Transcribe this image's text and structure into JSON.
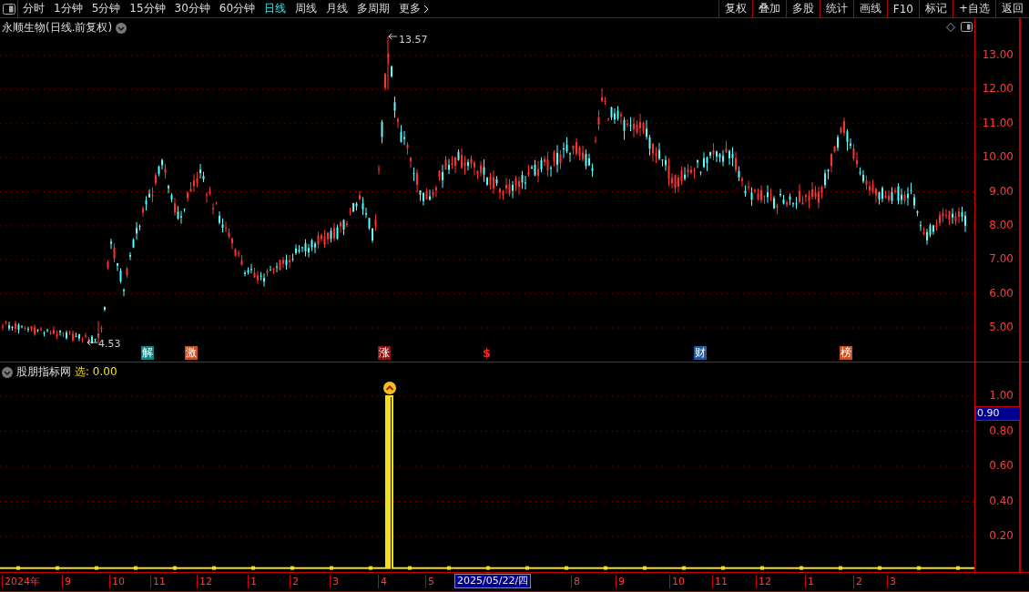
{
  "toolbar": {
    "periods": [
      {
        "label": "分时",
        "selected": false
      },
      {
        "label": "1分钟",
        "selected": false
      },
      {
        "label": "5分钟",
        "selected": false
      },
      {
        "label": "15分钟",
        "selected": false
      },
      {
        "label": "30分钟",
        "selected": false
      },
      {
        "label": "60分钟",
        "selected": false
      },
      {
        "label": "日线",
        "selected": true
      },
      {
        "label": "周线",
        "selected": false
      },
      {
        "label": "月线",
        "selected": false
      },
      {
        "label": "多周期",
        "selected": false
      }
    ],
    "more": "更多",
    "buttons": [
      "复权",
      "叠加",
      "多股",
      "统计",
      "画线",
      "F10",
      "标记",
      "+自选",
      "返回"
    ]
  },
  "price_panel": {
    "title": "永顺生物(日线.前复权)",
    "high_label": "13.57",
    "low_label": "4.53",
    "axis_labels": [
      "13.00",
      "12.00",
      "11.00",
      "10.00",
      "9.00",
      "8.00",
      "7.00",
      "6.00",
      "5.00"
    ],
    "signals": [
      {
        "label": "解",
        "kind": "tag",
        "color": "#0f8585"
      },
      {
        "label": "激",
        "kind": "tag",
        "color": "#c8501e"
      },
      {
        "label": "涨",
        "kind": "tag",
        "color": "#8c1414"
      },
      {
        "label": "$",
        "kind": "text",
        "color": "#ff2020"
      },
      {
        "label": "财",
        "kind": "tag",
        "color": "#1e5aa0"
      },
      {
        "label": "榜",
        "kind": "tag",
        "color": "#c8501e"
      }
    ]
  },
  "indicator_panel": {
    "title": "股朋指标网",
    "value_label": "选: 0.00",
    "cursor": "0.90",
    "axis_labels": [
      "1.00",
      "0.80",
      "0.60",
      "0.40",
      "0.20"
    ]
  },
  "date_axis": {
    "labels": [
      "2024年",
      "9",
      "10",
      "11",
      "12",
      "1",
      "2",
      "3",
      "4",
      "5",
      "8",
      "9",
      "10",
      "11",
      "12",
      "1",
      "2",
      "3"
    ],
    "cursor": "2025/05/22/四"
  }
}
